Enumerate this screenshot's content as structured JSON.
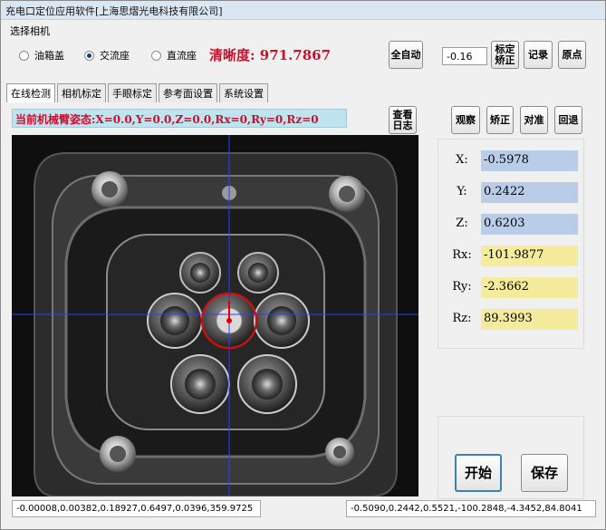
{
  "window": {
    "title": "充电口定位应用软件[上海思熠光电科技有限公司]"
  },
  "camera_select": {
    "group_label": "选择相机",
    "options": [
      {
        "label": "油箱盖",
        "selected": false
      },
      {
        "label": "交流座",
        "selected": true
      },
      {
        "label": "直流座",
        "selected": false
      }
    ]
  },
  "clarity": {
    "text": "清晰度: 971.7867"
  },
  "toolbar": {
    "auto_label": "全自动",
    "offset_value": "-0.16",
    "calib_label_1": "标定",
    "calib_label_2": "矫正",
    "record_label": "记录",
    "origin_label": "原点"
  },
  "tabs": [
    {
      "label": "在线检测",
      "active": true
    },
    {
      "label": "相机标定",
      "active": false
    },
    {
      "label": "手眼标定",
      "active": false
    },
    {
      "label": "参考面设置",
      "active": false
    },
    {
      "label": "系统设置",
      "active": false
    }
  ],
  "pose": {
    "text": "当前机械臂姿态:X=0.0,Y=0.0,Z=0.0,Rx=0,Ry=0,Rz=0"
  },
  "log_button": {
    "line1": "查看",
    "line2": "日志"
  },
  "actions": {
    "observe": "观察",
    "correct": "矫正",
    "align": "对准",
    "retreat": "回退"
  },
  "readouts": [
    {
      "label": "X:",
      "value": "-0.5978",
      "color": "#b9cde9"
    },
    {
      "label": "Y:",
      "value": "0.2422",
      "color": "#b9cde9"
    },
    {
      "label": "Z:",
      "value": "0.6203",
      "color": "#b9cde9"
    },
    {
      "label": "Rx:",
      "value": "-101.9877",
      "color": "#f4ec9c"
    },
    {
      "label": "Ry:",
      "value": "-2.3662",
      "color": "#f4ec9c"
    },
    {
      "label": "Rz:",
      "value": "89.3993",
      "color": "#f4ec9c"
    }
  ],
  "controls": {
    "start": "开始",
    "save": "保存"
  },
  "status": {
    "left": "-0.00008,0.00382,0.18927,0.6497,0.0396,359.9725",
    "right": "-0.5090,0.2442,0.5521,-100.2848,-4.3452,84.8041"
  }
}
